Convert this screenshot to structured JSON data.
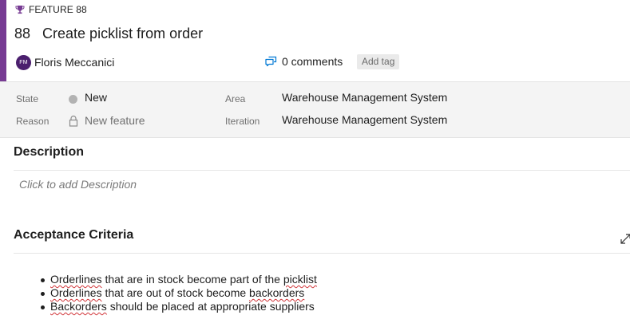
{
  "theme": {
    "accent": "#773b93",
    "avatar_bg": "#4b1f6e",
    "state_new": "#b2b2b2"
  },
  "work_item": {
    "type_icon": "trophy-icon",
    "type": "FEATURE 88",
    "id": "88",
    "title": "Create picklist from order",
    "assignee": {
      "initials": "FM",
      "name": "Floris Meccanici"
    },
    "comments_icon": "comments-icon",
    "comments_label": "0 comments",
    "add_tag_label": "Add tag"
  },
  "fields": {
    "state_label": "State",
    "state_value": "New",
    "reason_label": "Reason",
    "reason_icon": "lock-icon",
    "reason_value": "New feature",
    "area_label": "Area",
    "area_value": "Warehouse Management System",
    "iteration_label": "Iteration",
    "iteration_value": "Warehouse Management System"
  },
  "description": {
    "title": "Description",
    "placeholder": "Click to add Description"
  },
  "acceptance_criteria": {
    "title": "Acceptance Criteria",
    "expand_icon": "expand-icon",
    "items": [
      {
        "flagged": "Orderlines",
        "text": " that are in stock become part of the ",
        "flagged2": "picklist"
      },
      {
        "flagged": "Orderlines",
        "text": " that are out of stock become ",
        "flagged2": "backorders"
      },
      {
        "flagged": "Backorders",
        "text": " should be placed at appropriate suppliers",
        "flagged2": ""
      }
    ]
  }
}
